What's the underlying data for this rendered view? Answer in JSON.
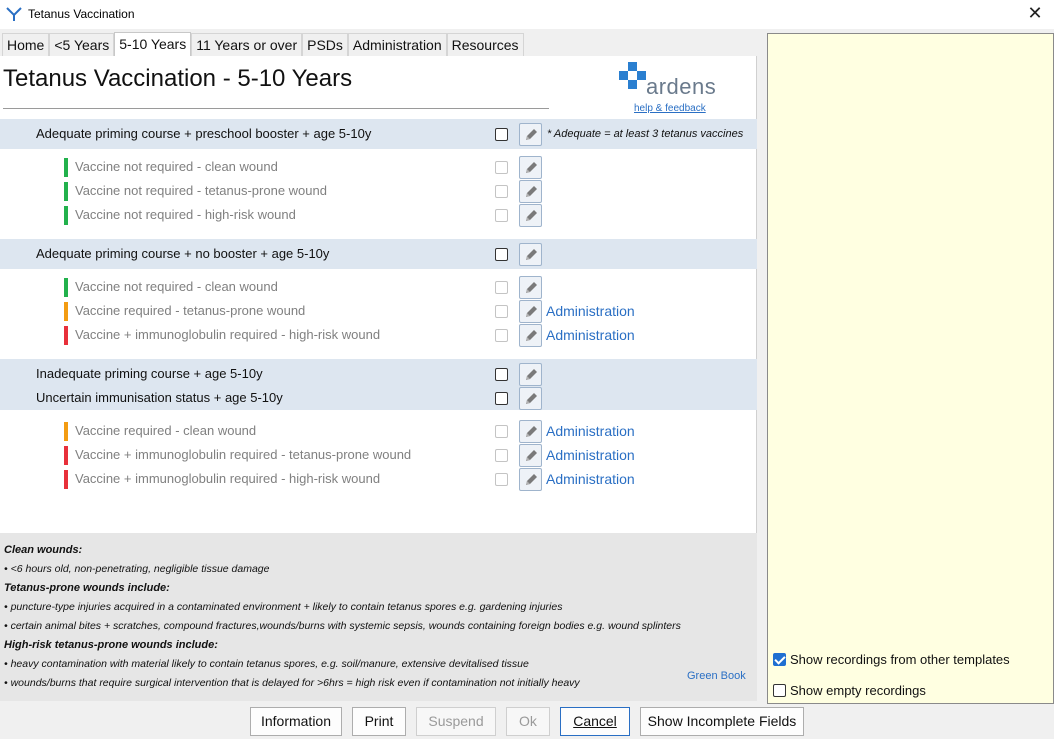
{
  "window": {
    "title": "Tetanus Vaccination",
    "close_glyph": "✕"
  },
  "tabs": [
    {
      "label": "Home"
    },
    {
      "label": "<5 Years"
    },
    {
      "label": "5-10 Years"
    },
    {
      "label": "11 Years or over"
    },
    {
      "label": "PSDs"
    },
    {
      "label": "Administration"
    },
    {
      "label": "Resources"
    }
  ],
  "page": {
    "title": "Tetanus Vaccination - 5-10 Years"
  },
  "logo": {
    "text": "ardens",
    "help_link": "help & feedback"
  },
  "group1": {
    "header": "Adequate priming course + preschool booster + age 5-10y",
    "note": "* Adequate = at least 3 tetanus vaccines",
    "items": [
      {
        "label": "Vaccine not required - clean wound"
      },
      {
        "label": "Vaccine not required - tetanus-prone wound"
      },
      {
        "label": "Vaccine not required - high-risk wound"
      }
    ]
  },
  "group2": {
    "header": "Adequate priming course + no booster + age 5-10y",
    "items": [
      {
        "label": "Vaccine not required - clean wound"
      },
      {
        "label": "Vaccine required - tetanus-prone wound",
        "link": "Administration"
      },
      {
        "label": "Vaccine + immunoglobulin required - high-risk wound",
        "link": "Administration"
      }
    ]
  },
  "group3": {
    "headers": [
      "Inadequate priming course + age 5-10y",
      "Uncertain immunisation status + age 5-10y"
    ],
    "items": [
      {
        "label": "Vaccine required - clean wound",
        "link": "Administration"
      },
      {
        "label": "Vaccine + immunoglobulin required - tetanus-prone wound",
        "link": "Administration"
      },
      {
        "label": "Vaccine + immunoglobulin required - high-risk wound",
        "link": "Administration"
      }
    ]
  },
  "notes": {
    "clean_heading": "Clean wounds:",
    "clean_1": "• <6 hours old, non-penetrating, negligible tissue damage",
    "prone_heading": "Tetanus-prone wounds include:",
    "prone_1": "• puncture-type injuries acquired in a contaminated environment + likely to contain tetanus spores e.g. gardening injuries",
    "prone_2": "• certain animal bites + scratches, compound fractures,wounds/burns with systemic sepsis, wounds containing foreign bodies e.g. wound splinters",
    "high_heading": "High-risk tetanus-prone wounds include:",
    "high_1": "• heavy contamination with material likely to contain tetanus spores, e.g. soil/manure, extensive devitalised tissue",
    "high_2": "• wounds/burns that require surgical intervention that is delayed for >6hrs = high risk even if contamination not initially heavy",
    "green_book": "Green Book"
  },
  "side_panel": {
    "show_other": "Show recordings from other templates",
    "show_empty": "Show empty recordings"
  },
  "buttons": {
    "information": "Information",
    "print": "Print",
    "suspend": "Suspend",
    "ok": "Ok",
    "cancel": "Cancel",
    "show_incomplete": "Show Incomplete Fields"
  },
  "colors": {
    "green": "#22b14c",
    "amber": "#f39c12",
    "red": "#e8303a",
    "band": "#dde6f0",
    "link": "#2a6fc4",
    "side_panel": "#ffffe1"
  }
}
